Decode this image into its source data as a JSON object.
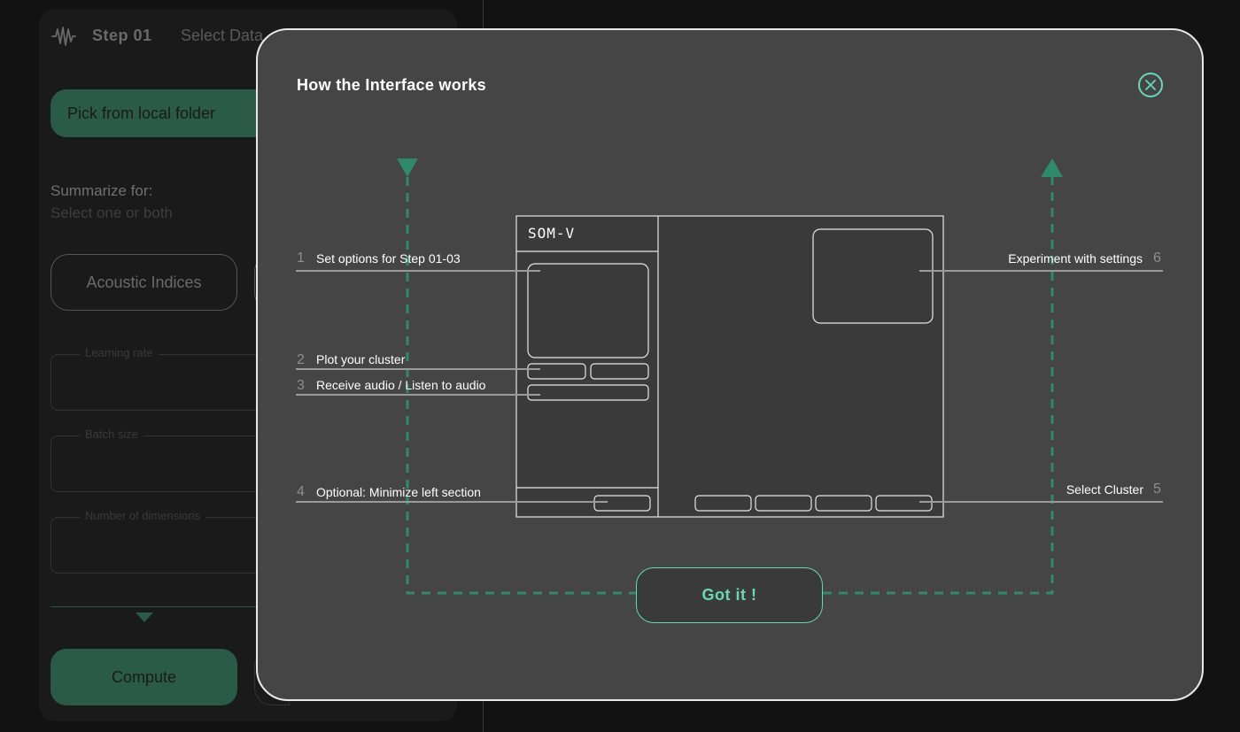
{
  "background": {
    "step_label": "Step 01",
    "step_title": "Select Data",
    "pick_button": "Pick from local folder",
    "summarize_label": "Summarize for:",
    "summarize_hint": "Select one or both",
    "indices_button": "Acoustic Indices",
    "fields": [
      {
        "label": "Learning rate"
      },
      {
        "label": "Batch size"
      },
      {
        "label": "Number of dimensions"
      }
    ],
    "compute_button": "Compute",
    "step_icon": "waveform-icon",
    "expand_icon": "triangle-down-icon"
  },
  "modal": {
    "title": "How the Interface works",
    "close_icon": "close-icon",
    "mockup_title": "SOM-V",
    "annotations": {
      "a1": {
        "num": "1",
        "text": "Set options for Step 01-03"
      },
      "a2": {
        "num": "2",
        "text": "Plot your cluster"
      },
      "a3": {
        "num": "3",
        "text": "Receive audio / Listen to audio"
      },
      "a4": {
        "num": "4",
        "text": "Optional: Minimize left section"
      },
      "a5": {
        "num": "5",
        "text": "Select Cluster"
      },
      "a6": {
        "num": "6",
        "text": "Experiment with settings"
      }
    },
    "got_it_button": "Got it !"
  },
  "colors": {
    "accent": "#67d8b5",
    "accent_dark": "#2a5a48",
    "modal_bg": "#454545",
    "page_bg": "#121212"
  }
}
